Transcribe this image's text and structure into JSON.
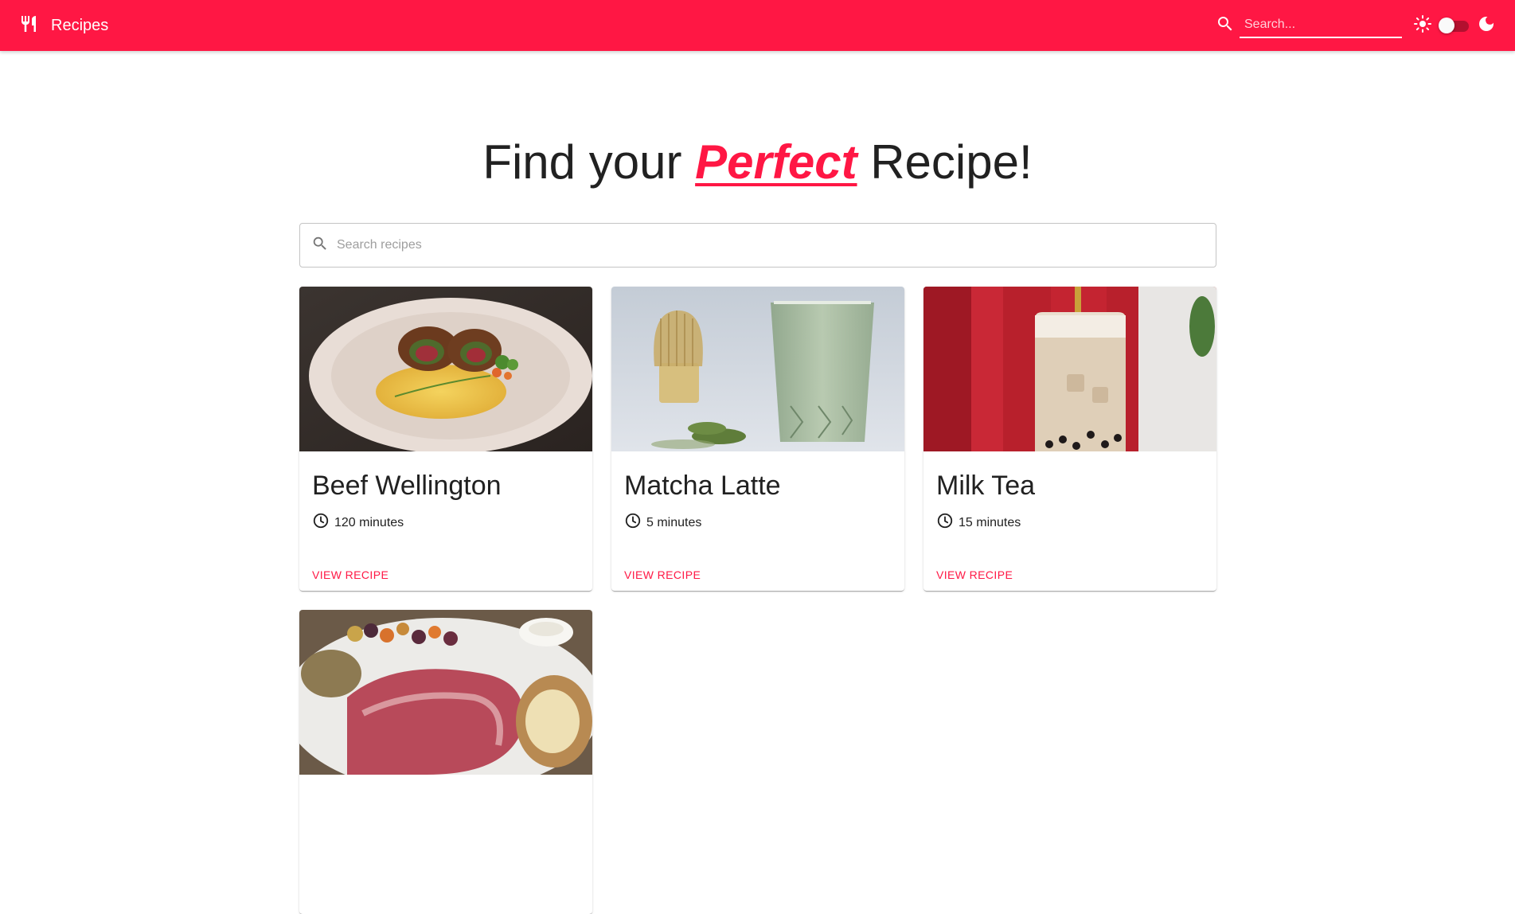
{
  "appbar": {
    "title": "Recipes",
    "search_placeholder": "Search..."
  },
  "hero": {
    "before": "Find your ",
    "accent": "Perfect",
    "after": " Recipe!"
  },
  "search": {
    "placeholder": "Search recipes"
  },
  "recipes": [
    {
      "title": "Beef Wellington",
      "time": "120 minutes",
      "action": "VIEW RECIPE",
      "image": "beef-wellington-photo"
    },
    {
      "title": "Matcha Latte",
      "time": "5 minutes",
      "action": "VIEW RECIPE",
      "image": "matcha-latte-photo"
    },
    {
      "title": "Milk Tea",
      "time": "15 minutes",
      "action": "VIEW RECIPE",
      "image": "milk-tea-photo"
    },
    {
      "title": "",
      "time": "",
      "action": "",
      "image": "prime-rib-plate-photo"
    }
  ],
  "colors": {
    "primary": "#ff1744",
    "text": "#212121"
  }
}
